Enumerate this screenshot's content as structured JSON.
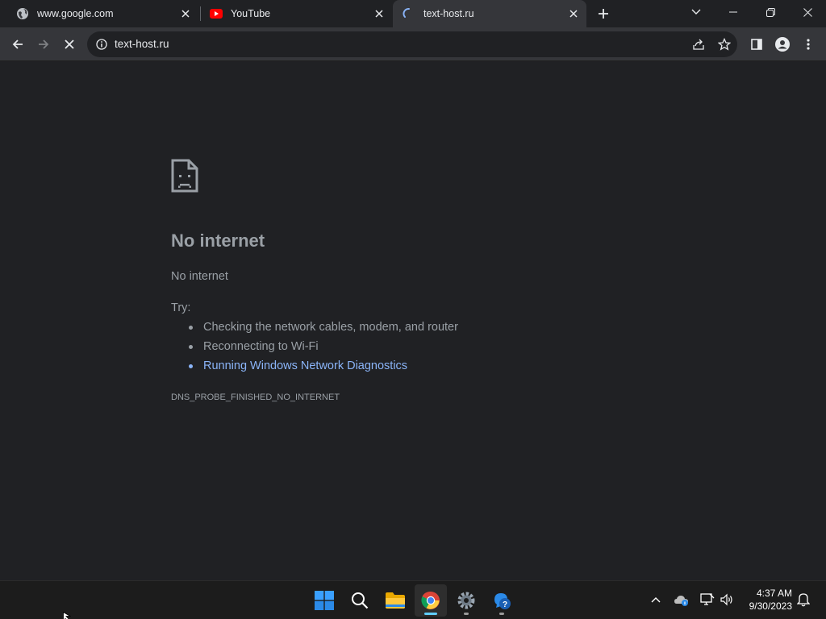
{
  "tabs": [
    {
      "title": "www.google.com",
      "favicon": "globe-icon"
    },
    {
      "title": "YouTube",
      "favicon": "youtube-icon"
    },
    {
      "title": "text-host.ru",
      "favicon": "loading-spinner-icon",
      "active": true
    }
  ],
  "toolbar": {
    "url": "text-host.ru"
  },
  "error": {
    "title": "No internet",
    "subtitle": "No internet",
    "try_label": "Try:",
    "suggestions": [
      "Checking the network cables, modem, and router",
      "Reconnecting to Wi-Fi",
      "Running Windows Network Diagnostics"
    ],
    "code": "DNS_PROBE_FINISHED_NO_INTERNET"
  },
  "taskbar": {
    "time": "4:37 AM",
    "date": "9/30/2023"
  },
  "colors": {
    "background": "#202124",
    "toolbar": "#35363a",
    "text_secondary": "#9aa0a6",
    "link": "#8ab4f8",
    "youtube_red": "#ff0000"
  }
}
